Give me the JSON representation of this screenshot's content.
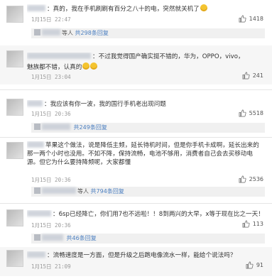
{
  "comments": [
    {
      "text": "：真的，我在手机刷刷有百分之八十的电，突然就关机了",
      "time": "1月15日 22:47",
      "likes": "1418",
      "replies_summary": "等人",
      "replies_link": "共298条回复"
    },
    {
      "text1": "：不过我觉得国产确实挺不错的，华为，OPPO，vivo，",
      "text2": "魅族都不错，认真的",
      "time": "1月15日 23:04",
      "likes": "241"
    },
    {
      "text": "：我应该有你一波，我的国行手机老出现问题",
      "time": "1月15日 20:36",
      "likes": "5518",
      "replies_link": "共249条回复"
    },
    {
      "text": "苹果这个做法，说是降低主频，延长待机时间，但是你手机卡成啊，延长出来的那一两个小时也没用。不如不降，保持流畅，电池不够用，消费者自己会去买移动电源。但它为什么要持降频呢，大家都懂",
      "time": "1月15日 20:36",
      "likes": "2536",
      "replies_summary": "等人",
      "replies_link": "共794条回复"
    },
    {
      "text": "：6sp已经降亡，你们用7也不远啦！！8到两兴的大早，x等于现在比之一天！！！！",
      "time": "1月15日 20:36",
      "likes": "113",
      "replies_link": "共46条回复"
    },
    {
      "text": "：流畅速度是一方面，但是升级之后跑电像流水一样，能给个说法吗？",
      "time": "1月15日 21:09",
      "likes": "91"
    }
  ]
}
